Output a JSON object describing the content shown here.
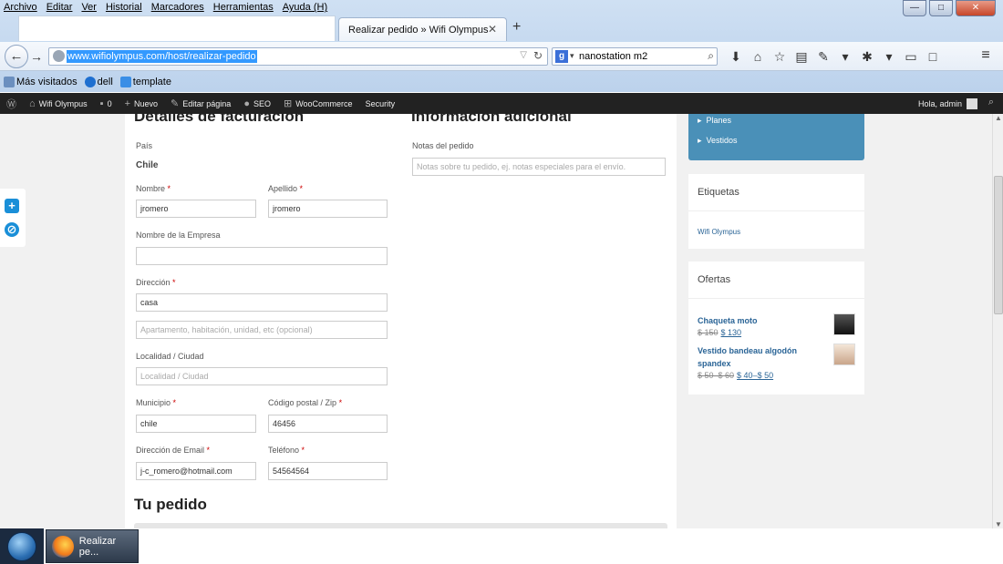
{
  "menubar": [
    "Archivo",
    "Editar",
    "Ver",
    "Historial",
    "Marcadores",
    "Herramientas",
    "Ayuda (H)"
  ],
  "tab": {
    "title": "Realizar pedido » Wifi Olympus",
    "close": "✕",
    "new": "+"
  },
  "window_controls": {
    "min": "—",
    "max": "□",
    "close": "✕"
  },
  "nav": {
    "url": "www.wifiolympus.com/host/realizar-pedido",
    "search_value": "nanostation m2",
    "search_engine": "g"
  },
  "bookmarks": [
    "Más visitados",
    "dell",
    "template"
  ],
  "adminbar": {
    "items": [
      "Wifi Olympus",
      "0",
      "Nuevo",
      "Editar página",
      "SEO",
      "WooCommerce",
      "Security"
    ],
    "greeting": "Hola, admin"
  },
  "billing": {
    "title": "Detalles de facturación",
    "country_label": "País",
    "country_value": "Chile",
    "first_name_label": "Nombre",
    "first_name_value": "jromero",
    "last_name_label": "Apellido",
    "last_name_value": "jromero",
    "company_label": "Nombre de la Empresa",
    "company_value": "",
    "address_label": "Dirección",
    "address_value": "casa",
    "address2_placeholder": "Apartamento, habitación, unidad, etc (opcional)",
    "city_label": "Localidad / Ciudad",
    "city_placeholder": "Localidad / Ciudad",
    "county_label": "Municipio",
    "county_value": "chile",
    "postcode_label": "Código postal / Zip",
    "postcode_value": "46456",
    "email_label": "Dirección de Email",
    "email_value": "j-c_romero@hotmail.com",
    "phone_label": "Teléfono",
    "phone_value": "54564564",
    "required_mark": "*"
  },
  "additional": {
    "title": "Información adicional",
    "notes_label": "Notas del pedido",
    "notes_placeholder": "Notas sobre tu pedido, ej. notas especiales para el envío."
  },
  "order": {
    "title": "Tu pedido"
  },
  "sidebar": {
    "categories": [
      "Planes",
      "Vestidos"
    ],
    "tags_title": "Etiquetas",
    "tags": [
      "Wifi Olympus"
    ],
    "offers_title": "Ofertas",
    "products": [
      {
        "name": "Chaqueta moto",
        "old_price": "$ 150",
        "new_price": "$ 130"
      },
      {
        "name": "Vestido bandeau algodón spandex",
        "old_price": "$ 50–$ 60",
        "new_price": "$ 40–$ 50"
      }
    ]
  },
  "taskbar": {
    "task_label": "Realizar pe..."
  },
  "colors": {
    "accent": "#4a90b8",
    "adminbar": "#222222",
    "link": "#2a6496",
    "required": "#cc0000"
  }
}
